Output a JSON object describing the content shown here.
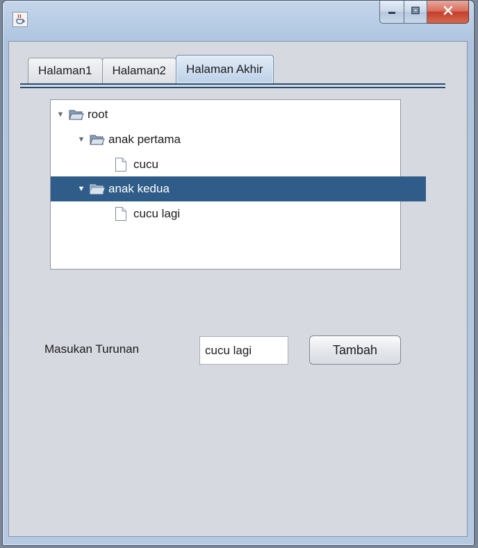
{
  "window": {
    "app_icon": "java-cup-icon",
    "caption_buttons": [
      "minimize-icon",
      "maximize-icon",
      "close-icon"
    ]
  },
  "tabs": [
    {
      "label": "Halaman1",
      "active": false
    },
    {
      "label": "Halaman2",
      "active": false
    },
    {
      "label": "Halaman Akhir",
      "active": true
    }
  ],
  "tree": {
    "nodes": [
      {
        "label": "root",
        "type": "folder",
        "expanded": true,
        "selected": false,
        "depth": 0
      },
      {
        "label": "anak pertama",
        "type": "folder",
        "expanded": true,
        "selected": false,
        "depth": 1
      },
      {
        "label": "cucu",
        "type": "file",
        "selected": false,
        "depth": 2
      },
      {
        "label": "anak kedua",
        "type": "folder",
        "expanded": true,
        "selected": true,
        "depth": 1
      },
      {
        "label": "cucu lagi",
        "type": "file",
        "selected": false,
        "depth": 2
      }
    ],
    "selection_color": "#2f5c88"
  },
  "form": {
    "label": "Masukan Turunan",
    "input_value": "cucu lagi",
    "button_label": "Tambah"
  }
}
